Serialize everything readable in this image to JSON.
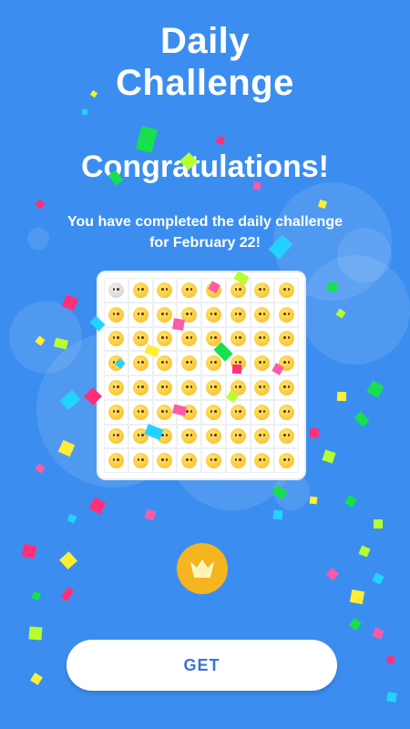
{
  "screen": {
    "title_line1": "Daily",
    "title_line2": "Challenge",
    "congrats": "Congratulations!",
    "message_line1": "You have completed the daily challenge",
    "message_line2": "for February 22!",
    "get_button": "GET"
  },
  "board": {
    "rows": 8,
    "columns": 8,
    "cell_icon": "emoji-face-icon",
    "first_cell_icon": "grey-face-icon"
  },
  "icons": {
    "crown": "crown-icon"
  },
  "colors": {
    "background": "#3b8ef0",
    "crown_badge": "#f5b51e",
    "button_text": "#3b74d6",
    "confetti": [
      "#16e04b",
      "#ff2f7a",
      "#ffee33",
      "#22d3ff",
      "#b6ff2e",
      "#ff5aa5"
    ]
  }
}
